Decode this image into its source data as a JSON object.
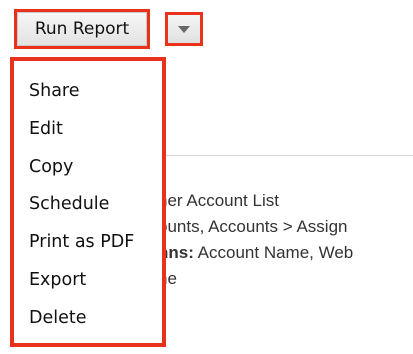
{
  "toolbar": {
    "run_report_label": "Run Report",
    "dropdown_icon": "caret-down-icon"
  },
  "menu": {
    "items": [
      {
        "label": "Share"
      },
      {
        "label": "Edit"
      },
      {
        "label": "Copy"
      },
      {
        "label": "Schedule"
      },
      {
        "label": "Print as PDF"
      },
      {
        "label": "Export"
      },
      {
        "label": "Delete"
      }
    ]
  },
  "details": {
    "line1": "ner Account List",
    "line2": "ounts, Accounts > Assign",
    "line3_label": "nns:",
    "line3_value": " Account Name, Web",
    "line4": "ne"
  },
  "colors": {
    "highlight": "#e8321b"
  }
}
